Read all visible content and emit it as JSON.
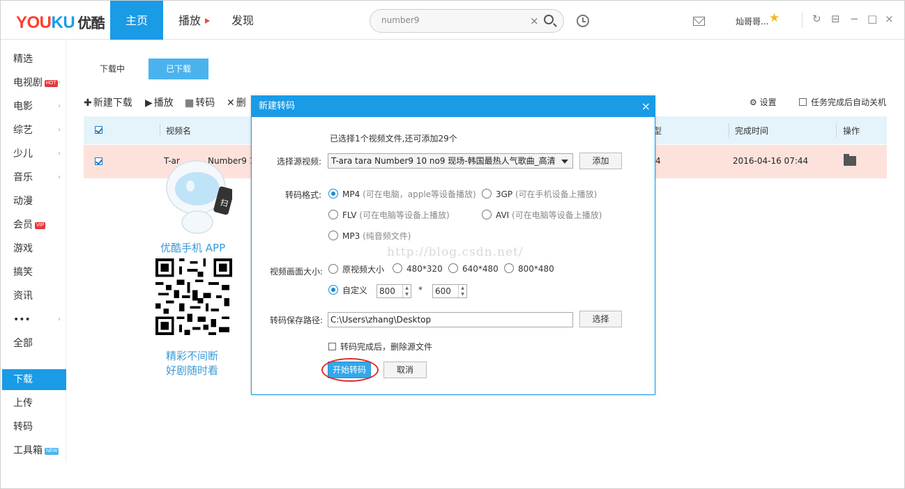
{
  "header": {
    "logo_en_1": "YOU",
    "logo_en_2": "KU",
    "logo_cn": "优酷",
    "nav": [
      "主页",
      "播放",
      "发现"
    ],
    "search_value": "number9",
    "search_clear": "×",
    "username": "灿哥哥...",
    "window_buttons": [
      "↻",
      "⊟",
      "−",
      "□",
      "×"
    ]
  },
  "sidebar": {
    "items": [
      {
        "label": "精选",
        "arrow": ""
      },
      {
        "label": "电视剧",
        "badge": "HOT",
        "arrow": "›"
      },
      {
        "label": "电影",
        "arrow": "›"
      },
      {
        "label": "综艺",
        "arrow": "›"
      },
      {
        "label": "少儿",
        "arrow": "›"
      },
      {
        "label": "音乐",
        "arrow": "›"
      },
      {
        "label": "动漫",
        "arrow": ""
      },
      {
        "label": "会员",
        "badge": "VIP",
        "arrow": ""
      },
      {
        "label": "游戏",
        "arrow": ""
      },
      {
        "label": "搞笑",
        "arrow": ""
      },
      {
        "label": "资讯",
        "arrow": ""
      },
      {
        "label": "•••",
        "arrow": "›"
      },
      {
        "label": "全部",
        "arrow": ""
      },
      {
        "label": "下载",
        "arrow": ""
      },
      {
        "label": "上传",
        "arrow": ""
      },
      {
        "label": "转码",
        "arrow": ""
      },
      {
        "label": "工具箱",
        "badge": "NEW",
        "arrow": ""
      }
    ]
  },
  "main": {
    "tabs": [
      "下载中",
      "已下载"
    ],
    "toolbar": {
      "new_download": "新建下载",
      "play": "播放",
      "transcode": "转码",
      "delete": "删",
      "settings": "设置",
      "auto_shutdown": "任务完成后自动关机"
    },
    "table": {
      "headers": [
        "视频名",
        "型",
        "完成时间",
        "操作"
      ],
      "row": {
        "name": "T-ar",
        "name_tail": "Number9 1",
        "type": "4",
        "time": "2016-04-16 07:44"
      }
    },
    "promo": {
      "title": "优酷手机 APP",
      "phone_text": "扫",
      "slogan_1": "精彩不间断",
      "slogan_2": "好剧随时看"
    }
  },
  "dialog": {
    "title": "新建转码",
    "close": "×",
    "info": "已选择1个视频文件,还可添加29个",
    "source_label": "选择源视频:",
    "source_value": "T-ara tara Number9 10 no9 现场-韩国最热人气歌曲_高清",
    "add_button": "添加",
    "format_label": "转码格式:",
    "formats": [
      {
        "name": "MP4",
        "hint": "(可在电脑，apple等设备播放)",
        "selected": true
      },
      {
        "name": "3GP",
        "hint": "(可在手机设备上播放)",
        "selected": false
      },
      {
        "name": "FLV",
        "hint": "(可在电脑等设备上播放)",
        "selected": false
      },
      {
        "name": "AVI",
        "hint": "(可在电脑等设备上播放)",
        "selected": false
      },
      {
        "name": "MP3",
        "hint": "(纯音频文件)",
        "selected": false
      }
    ],
    "size_label": "视频画面大小:",
    "sizes": [
      "原视频大小",
      "480*320",
      "640*480",
      "800*480"
    ],
    "custom_label": "自定义",
    "custom_width": "800",
    "custom_sep": "*",
    "custom_height": "600",
    "path_label": "转码保存路径:",
    "path_value": "C:\\Users\\zhang\\Desktop",
    "choose_button": "选择",
    "delete_source": "转码完成后，删除源文件",
    "start_button": "开始转码",
    "cancel_button": "取消",
    "watermark": "http://blog.csdn.net/"
  },
  "colors": {
    "accent": "#1a9be6",
    "row_highlight": "#fde2dc",
    "annotation": "#e02a2a"
  }
}
